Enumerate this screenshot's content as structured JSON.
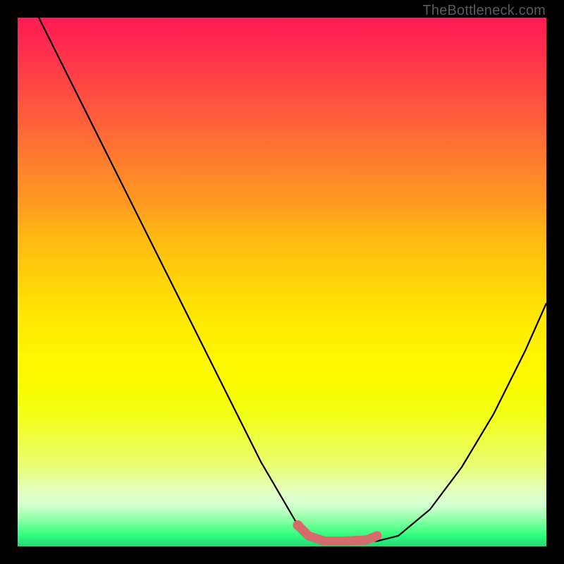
{
  "watermark": "TheBottleneck.com",
  "chart_data": {
    "type": "line",
    "title": "",
    "xlabel": "",
    "ylabel": "",
    "xlim": [
      0,
      100
    ],
    "ylim": [
      0,
      100
    ],
    "series": [
      {
        "name": "bottleneck-curve",
        "x": [
          4,
          10,
          16,
          22,
          28,
          34,
          40,
          46,
          53,
          55,
          60,
          65,
          68,
          72,
          78,
          84,
          90,
          96,
          100
        ],
        "y": [
          100,
          88,
          76,
          64,
          52,
          40,
          28,
          16,
          4,
          2,
          1,
          1,
          1,
          2,
          7,
          15,
          25,
          37,
          46
        ]
      }
    ],
    "highlight_segment": {
      "name": "optimal-range",
      "x": [
        53,
        55,
        58,
        62,
        66,
        68
      ],
      "y": [
        4,
        2,
        1,
        1,
        1.2,
        2
      ]
    },
    "background_gradient": {
      "top": "#ff1a53",
      "mid": "#ffe600",
      "bottom": "#25d777"
    }
  }
}
